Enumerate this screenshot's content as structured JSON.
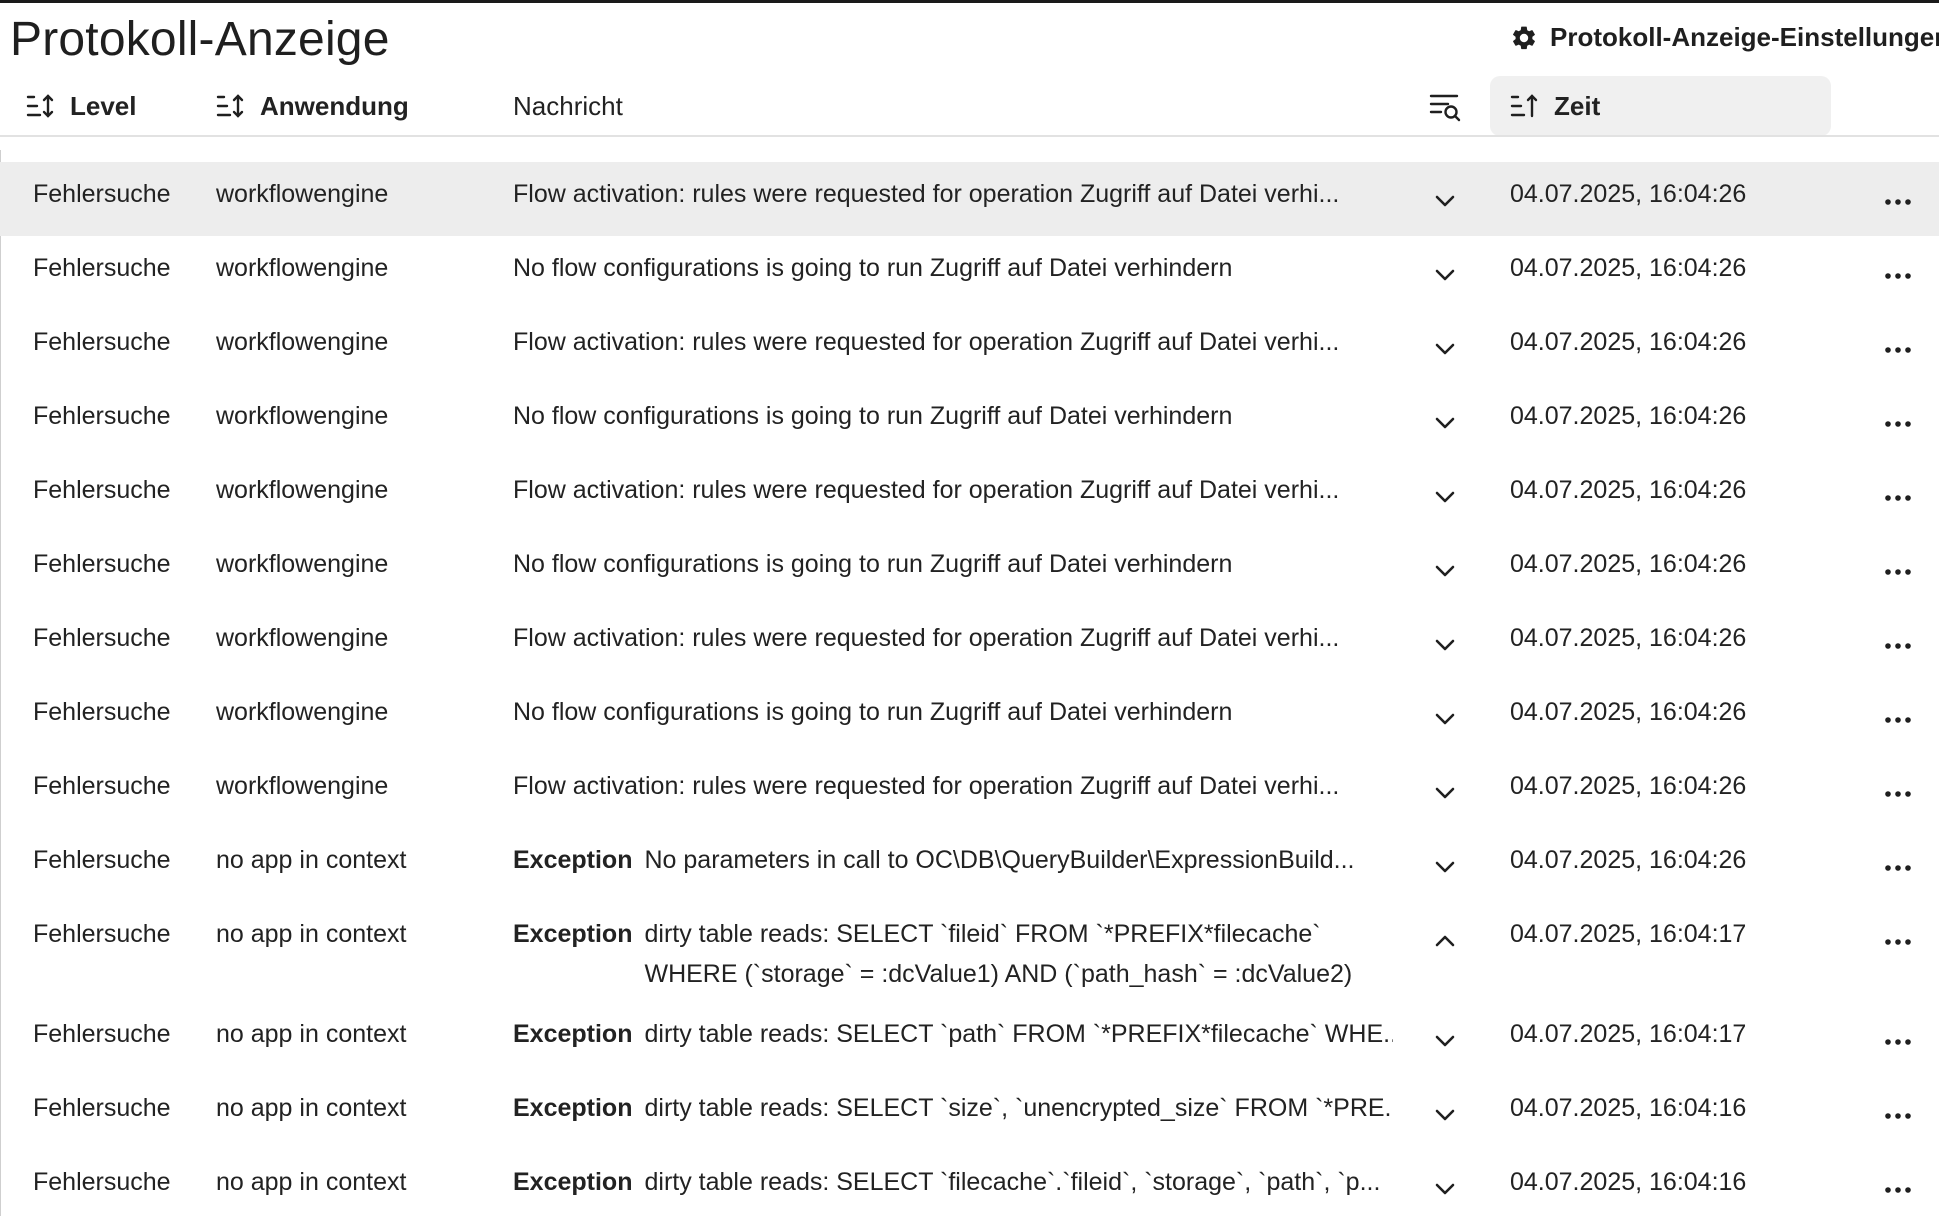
{
  "header": {
    "title": "Protokoll-Anzeige",
    "settings_label": "Protokoll-Anzeige-Einstellungen"
  },
  "columns": {
    "level": "Level",
    "app": "Anwendung",
    "message": "Nachricht",
    "time": "Zeit"
  },
  "icons": {
    "settings": "gear-icon",
    "sort": "sort-icon",
    "filter": "filter-search-icon",
    "expand": "chevron-down-icon",
    "collapse": "chevron-up-icon",
    "more": "more-horizontal-icon"
  },
  "colors": {
    "highlight_row": "#ededed",
    "sort_header_active": "#f0f0f0",
    "text": "#222222"
  },
  "rows": [
    {
      "level": "Fehlersuche",
      "app": "workflowengine",
      "exception": "",
      "message": "Flow activation: rules were requested for operation Zugriff auf Datei verhi...",
      "time": "04.07.2025, 16:04:26",
      "expanded": false,
      "highlight": true
    },
    {
      "level": "Fehlersuche",
      "app": "workflowengine",
      "exception": "",
      "message": "No flow configurations is going to run Zugriff auf Datei verhindern",
      "time": "04.07.2025, 16:04:26",
      "expanded": false,
      "highlight": false
    },
    {
      "level": "Fehlersuche",
      "app": "workflowengine",
      "exception": "",
      "message": "Flow activation: rules were requested for operation Zugriff auf Datei verhi...",
      "time": "04.07.2025, 16:04:26",
      "expanded": false,
      "highlight": false
    },
    {
      "level": "Fehlersuche",
      "app": "workflowengine",
      "exception": "",
      "message": "No flow configurations is going to run Zugriff auf Datei verhindern",
      "time": "04.07.2025, 16:04:26",
      "expanded": false,
      "highlight": false
    },
    {
      "level": "Fehlersuche",
      "app": "workflowengine",
      "exception": "",
      "message": "Flow activation: rules were requested for operation Zugriff auf Datei verhi...",
      "time": "04.07.2025, 16:04:26",
      "expanded": false,
      "highlight": false
    },
    {
      "level": "Fehlersuche",
      "app": "workflowengine",
      "exception": "",
      "message": "No flow configurations is going to run Zugriff auf Datei verhindern",
      "time": "04.07.2025, 16:04:26",
      "expanded": false,
      "highlight": false
    },
    {
      "level": "Fehlersuche",
      "app": "workflowengine",
      "exception": "",
      "message": "Flow activation: rules were requested for operation Zugriff auf Datei verhi...",
      "time": "04.07.2025, 16:04:26",
      "expanded": false,
      "highlight": false
    },
    {
      "level": "Fehlersuche",
      "app": "workflowengine",
      "exception": "",
      "message": "No flow configurations is going to run Zugriff auf Datei verhindern",
      "time": "04.07.2025, 16:04:26",
      "expanded": false,
      "highlight": false
    },
    {
      "level": "Fehlersuche",
      "app": "workflowengine",
      "exception": "",
      "message": "Flow activation: rules were requested for operation Zugriff auf Datei verhi...",
      "time": "04.07.2025, 16:04:26",
      "expanded": false,
      "highlight": false
    },
    {
      "level": "Fehlersuche",
      "app": "no app in context",
      "exception": "Exception",
      "message": "No parameters in call to OC\\DB\\QueryBuilder\\ExpressionBuild...",
      "time": "04.07.2025, 16:04:26",
      "expanded": false,
      "highlight": false
    },
    {
      "level": "Fehlersuche",
      "app": "no app in context",
      "exception": "Exception",
      "message": "dirty table reads: SELECT `fileid` FROM `*PREFIX*filecache` WHERE (`storage` = :dcValue1) AND (`path_hash` = :dcValue2)",
      "time": "04.07.2025, 16:04:17",
      "expanded": true,
      "highlight": false
    },
    {
      "level": "Fehlersuche",
      "app": "no app in context",
      "exception": "Exception",
      "message": "dirty table reads: SELECT `path` FROM `*PREFIX*filecache` WHE...",
      "time": "04.07.2025, 16:04:17",
      "expanded": false,
      "highlight": false
    },
    {
      "level": "Fehlersuche",
      "app": "no app in context",
      "exception": "Exception",
      "message": "dirty table reads: SELECT `size`, `unencrypted_size` FROM `*PRE...",
      "time": "04.07.2025, 16:04:16",
      "expanded": false,
      "highlight": false
    },
    {
      "level": "Fehlersuche",
      "app": "no app in context",
      "exception": "Exception",
      "message": "dirty table reads: SELECT `filecache`.`fileid`, `storage`, `path`, `p...",
      "time": "04.07.2025, 16:04:16",
      "expanded": false,
      "highlight": false
    }
  ]
}
